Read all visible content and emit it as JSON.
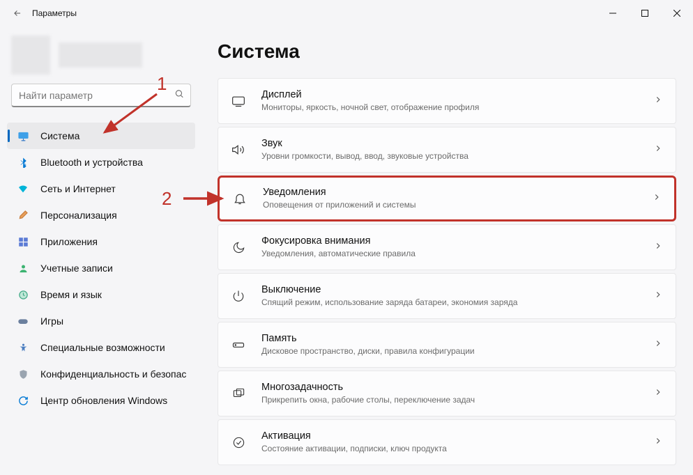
{
  "window": {
    "title": "Параметры"
  },
  "search": {
    "placeholder": "Найти параметр"
  },
  "sidebar": {
    "items": [
      {
        "label": "Система"
      },
      {
        "label": "Bluetooth и устройства"
      },
      {
        "label": "Сеть и Интернет"
      },
      {
        "label": "Персонализация"
      },
      {
        "label": "Приложения"
      },
      {
        "label": "Учетные записи"
      },
      {
        "label": "Время и язык"
      },
      {
        "label": "Игры"
      },
      {
        "label": "Специальные возможности"
      },
      {
        "label": "Конфиденциальность и безопас"
      },
      {
        "label": "Центр обновления Windows"
      }
    ]
  },
  "page": {
    "title": "Система"
  },
  "cards": [
    {
      "title": "Дисплей",
      "sub": "Мониторы, яркость, ночной свет, отображение профиля"
    },
    {
      "title": "Звук",
      "sub": "Уровни громкости, вывод, ввод, звуковые устройства"
    },
    {
      "title": "Уведомления",
      "sub": "Оповещения от приложений и системы"
    },
    {
      "title": "Фокусировка внимания",
      "sub": "Уведомления, автоматические правила"
    },
    {
      "title": "Выключение",
      "sub": "Спящий режим, использование заряда батареи, экономия заряда"
    },
    {
      "title": "Память",
      "sub": "Дисковое пространство, диски, правила конфигурации"
    },
    {
      "title": "Многозадачность",
      "sub": "Прикрепить окна, рабочие столы, переключение задач"
    },
    {
      "title": "Активация",
      "sub": "Состояние активации, подписки, ключ продукта"
    }
  ],
  "annotations": {
    "num1": "1",
    "num2": "2"
  },
  "colors": {
    "accent": "#0067c0",
    "highlight": "#c1322a"
  }
}
